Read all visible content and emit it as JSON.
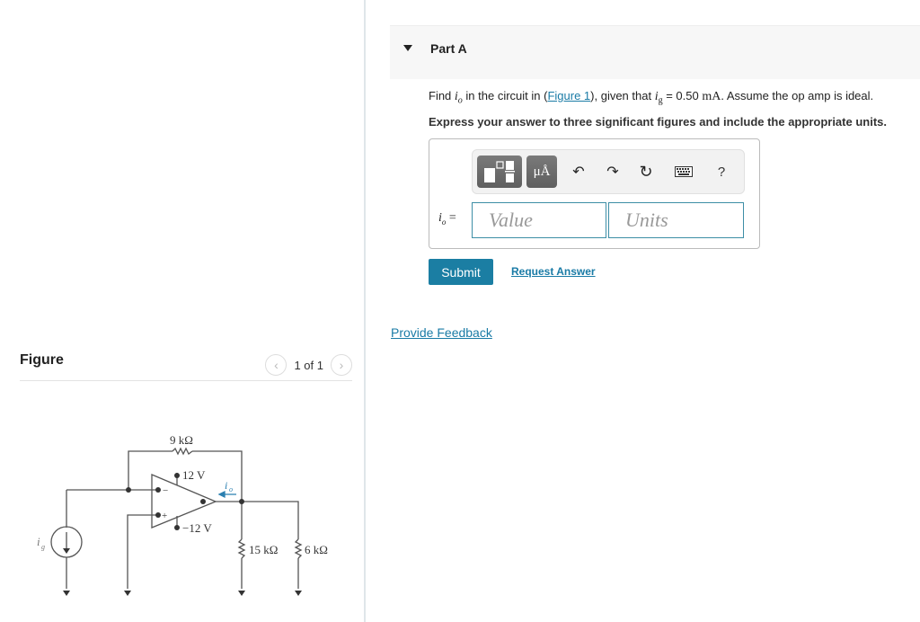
{
  "figure_panel": {
    "title": "Figure",
    "pager": {
      "prev_icon": "chevron-left-icon",
      "text": "1 of 1",
      "next_icon": "chevron-right-icon"
    },
    "circuit": {
      "labels": {
        "feedback_resistor": "9 kΩ",
        "pos_supply": "12 V",
        "neg_supply": "−12 V",
        "output_current": "i",
        "output_current_sub": "o",
        "source_current": "i",
        "source_current_sub": "g",
        "load_resistor_1": "15 kΩ",
        "load_resistor_2": "6 kΩ",
        "inverting_sign": "−",
        "noninverting_sign": "+"
      },
      "accent_color": "#2a7fb0"
    }
  },
  "part_a": {
    "title": "Part A",
    "question": {
      "prefix": "Find ",
      "var": "i",
      "var_sub": "o",
      "mid1": " in the circuit in (",
      "figure_link": "Figure 1",
      "mid2": "), given that ",
      "given_var": "i",
      "given_sub": "g",
      "given_eq": " = 0.50 ",
      "given_unit": "mA",
      "suffix": ". Assume the op amp is ideal."
    },
    "instruction": "Express your answer to three significant figures and include the appropriate units.",
    "toolbar": {
      "templates_icon": "templates-icon",
      "units_label": "μÅ",
      "undo_icon": "undo-icon",
      "redo_icon": "redo-icon",
      "reset_icon": "reset-icon",
      "keyboard_icon": "keyboard-icon",
      "help_label": "?"
    },
    "answer": {
      "label_var": "i",
      "label_sub": "o",
      "label_eq": " =",
      "value_placeholder": "Value",
      "value": "",
      "units_placeholder": "Units",
      "units": ""
    },
    "submit_label": "Submit",
    "request_answer_label": "Request Answer"
  },
  "feedback_label": "Provide Feedback",
  "colors": {
    "link": "#1a7ba6",
    "submit_bg": "#1b7ea3",
    "input_border": "#3d8ea6"
  }
}
